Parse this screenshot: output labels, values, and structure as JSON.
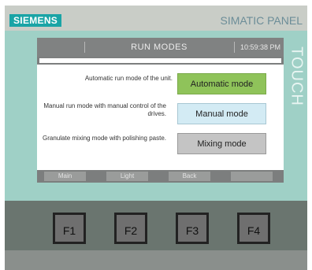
{
  "panel": {
    "logo": "SIEMENS",
    "brand": "SIMATIC PANEL",
    "touch_label": "TOUCH"
  },
  "header": {
    "title": "RUN MODES",
    "time": "10:59:38 PM"
  },
  "modes": [
    {
      "description": "Automatic run mode of the unit.",
      "button_label": "Automatic mode"
    },
    {
      "description": "Manual run mode with manual control of the drives.",
      "button_label": "Manual mode"
    },
    {
      "description": "Granulate mixing mode with polishing paste.",
      "button_label": "Mixing mode"
    }
  ],
  "softkeys": [
    "Main",
    "Light",
    "Back",
    ""
  ],
  "function_keys": [
    "F1",
    "F2",
    "F3",
    "F4"
  ],
  "colors": {
    "automatic_button": "#8fc35a",
    "manual_button": "#d3ebf4",
    "mixing_button": "#c4c4c4",
    "logo_background": "#1aa4a6",
    "bezel": "#9fd0c6"
  }
}
